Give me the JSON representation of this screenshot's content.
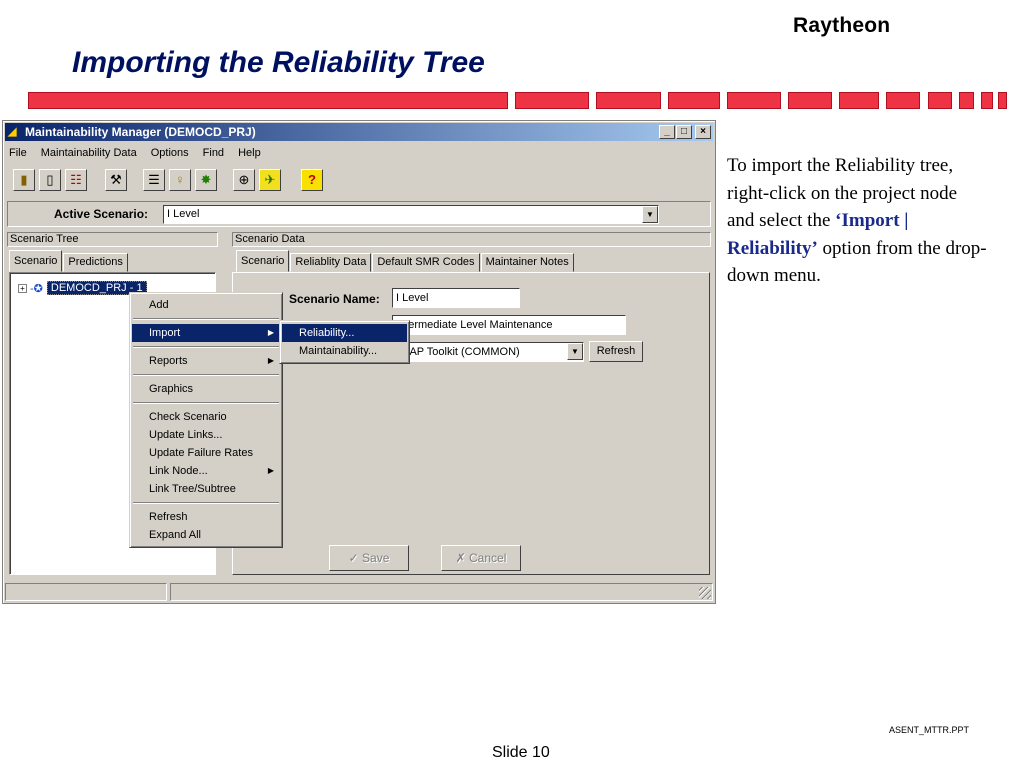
{
  "slide": {
    "logo": "Raytheon",
    "title": "Importing the Reliability Tree",
    "doc_id": "ASENT_MTTR.PPT",
    "slide_number": "Slide 10",
    "accent_color": "#ee3344",
    "caption": {
      "before": "To import the Reliability tree, right-click on the project node and select the ",
      "highlight": "‘Import | Reliability’",
      "after": " option from the drop-down menu."
    }
  },
  "window": {
    "title": "Maintainability Manager (DEMOCD_PRJ)",
    "controls": {
      "minimize": "_",
      "maximize": "□",
      "close": "×"
    },
    "menu": [
      "File",
      "Maintainability Data",
      "Options",
      "Find",
      "Help"
    ],
    "toolbar_icons": [
      "book-icon",
      "new-doc-icon",
      "tree-icon",
      "tools-icon",
      "list-icon",
      "lightbulb-icon",
      "wizard-icon",
      "zoom-icon",
      "runner-icon",
      "help-icon"
    ],
    "active_scenario": {
      "label": "Active Scenario:",
      "value": "I Level"
    },
    "scenario_tree": {
      "header": "Scenario Tree",
      "tabs": [
        "Scenario",
        "Predictions"
      ],
      "node": {
        "expander": "+",
        "label": "DEMOCD_PRJ  - 1"
      }
    },
    "scenario_data": {
      "header": "Scenario Data",
      "tabs": [
        "Scenario",
        "Reliablity Data",
        "Default SMR Codes",
        "Maintainer Notes"
      ],
      "name_label": "Scenario Name:",
      "name_value": "I Level",
      "description_value": "Intermediate Level Maintenance",
      "toolkit_value": "LSAP Toolkit (COMMON)",
      "refresh_label": "Refresh",
      "save_label": "Save",
      "cancel_label": "Cancel"
    }
  },
  "context_menu": {
    "groups": [
      [
        {
          "label": "Add"
        }
      ],
      [
        {
          "label": "Import",
          "submenu": true,
          "selected": true
        }
      ],
      [
        {
          "label": "Reports",
          "submenu": true
        }
      ],
      [
        {
          "label": "Graphics"
        }
      ],
      [
        {
          "label": "Check Scenario"
        },
        {
          "label": "Update Links..."
        },
        {
          "label": "Update Failure Rates"
        },
        {
          "label": "Link Node...",
          "submenu": true
        },
        {
          "label": "Link Tree/Subtree"
        }
      ],
      [
        {
          "label": "Refresh"
        },
        {
          "label": "Expand All"
        }
      ]
    ]
  },
  "import_submenu": {
    "items": [
      {
        "label": "Reliability...",
        "selected": true
      },
      {
        "label": "Maintainability..."
      }
    ]
  }
}
